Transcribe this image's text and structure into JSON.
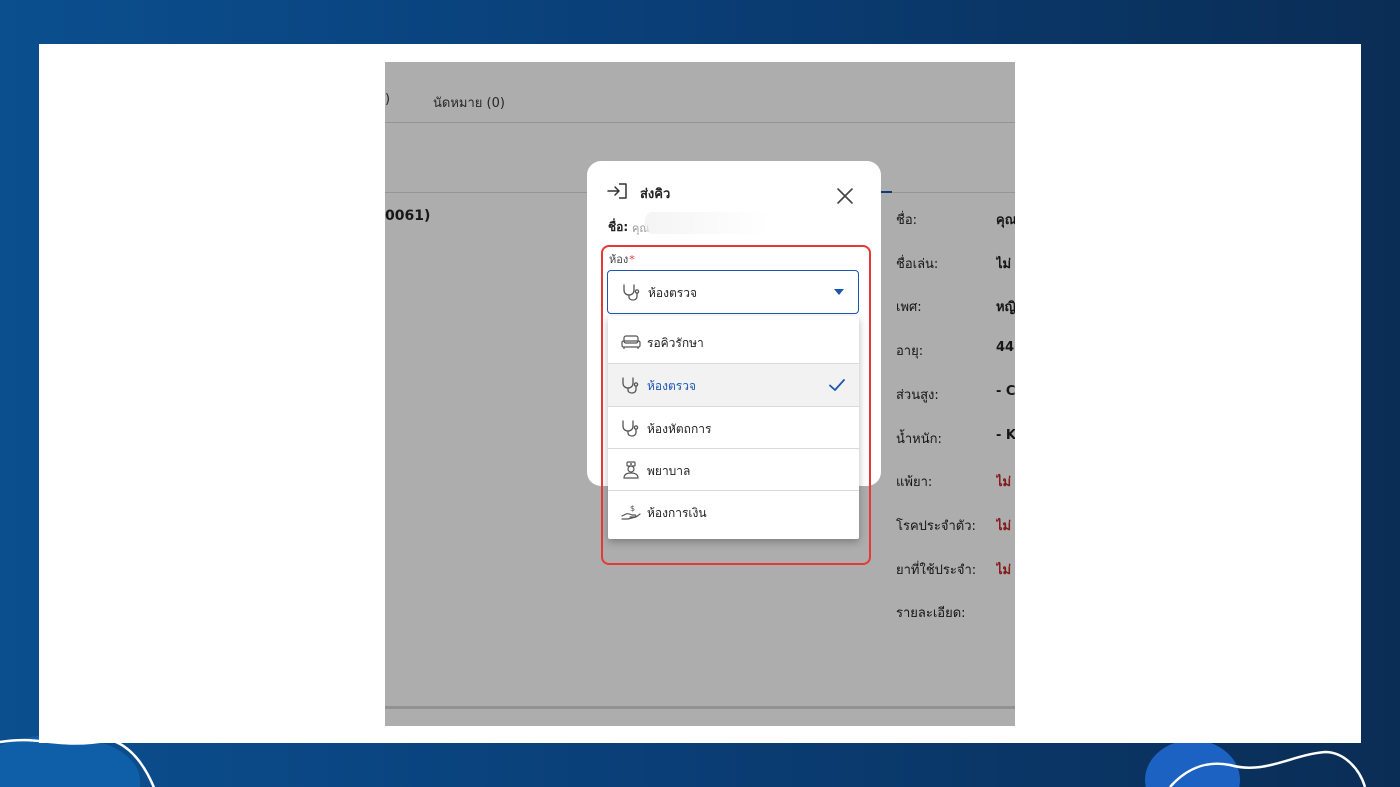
{
  "background_page": {
    "tabs": [
      ")",
      "นัดหมาย (0)"
    ],
    "patient_id_fragment": "0061)",
    "info_rows": [
      {
        "label": "ชื่อ:",
        "value": "คุณ",
        "value_color": "default"
      },
      {
        "label": "ชื่อเล่น:",
        "value": "ไม่",
        "value_color": "default"
      },
      {
        "label": "เพศ:",
        "value": "หญิ",
        "value_color": "default"
      },
      {
        "label": "อายุ:",
        "value": "44",
        "value_color": "default"
      },
      {
        "label": "ส่วนสูง:",
        "value": "- C",
        "value_color": "default"
      },
      {
        "label": "น้ำหนัก:",
        "value": "- K",
        "value_color": "default"
      },
      {
        "label": "แพ้ยา:",
        "value": "ไม่",
        "value_color": "red"
      },
      {
        "label": "โรคประจำตัว:",
        "value": "ไม่",
        "value_color": "red"
      },
      {
        "label": "ยาที่ใช้ประจำ:",
        "value": "ไม่",
        "value_color": "red"
      },
      {
        "label": "รายละเอียด:",
        "value": "",
        "value_color": "default"
      }
    ]
  },
  "modal": {
    "title": "ส่งคิว",
    "title_icon": "send-queue-icon",
    "name_label": "ชื่อ:",
    "name_value": "คุณ",
    "field_label": "ห้อง",
    "required_mark": "*",
    "selected_value": "ห้องตรวจ",
    "selected_icon": "stethoscope-icon",
    "options": [
      {
        "label": "รอคิวรักษา",
        "icon": "sofa-icon",
        "selected": false
      },
      {
        "label": "ห้องตรวจ",
        "icon": "stethoscope-icon",
        "selected": true
      },
      {
        "label": "ห้องหัตถการ",
        "icon": "stethoscope-icon",
        "selected": false
      },
      {
        "label": "พยาบาล",
        "icon": "nurse-icon",
        "selected": false
      },
      {
        "label": "ห้องการเงิน",
        "icon": "payment-hand-icon",
        "selected": false
      }
    ]
  },
  "colors": {
    "primary": "#1a56b5",
    "highlight_border": "#e53935",
    "frame_background": "#0a3f78",
    "danger_text": "#c62828"
  }
}
